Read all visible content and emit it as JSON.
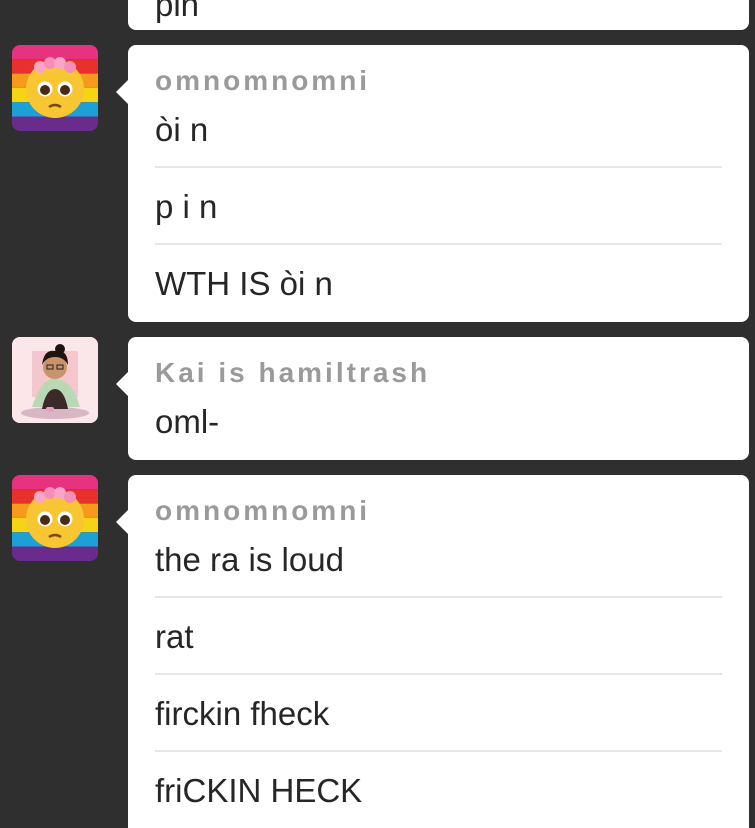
{
  "groups": [
    {
      "messages": [
        "pin"
      ]
    },
    {
      "username": "omnomnomni",
      "avatar": "pride-flag-pleading-face-avatar",
      "messages": [
        "òi n",
        "p i n",
        "WTH IS òi n"
      ]
    },
    {
      "username": "Kai is hamiltrash",
      "avatar": "anime-character-avatar",
      "messages": [
        "oml-"
      ]
    },
    {
      "username": "omnomnomni",
      "avatar": "pride-flag-pleading-face-avatar",
      "messages": [
        "the ra is loud",
        "rat",
        "firckin fheck",
        "friCKIN HECK"
      ]
    }
  ],
  "colors": {
    "background": "#2f2f2f",
    "bubble": "#ffffff",
    "username": "#9a9a9a",
    "text": "#262626",
    "divider": "#e6e6e6"
  }
}
